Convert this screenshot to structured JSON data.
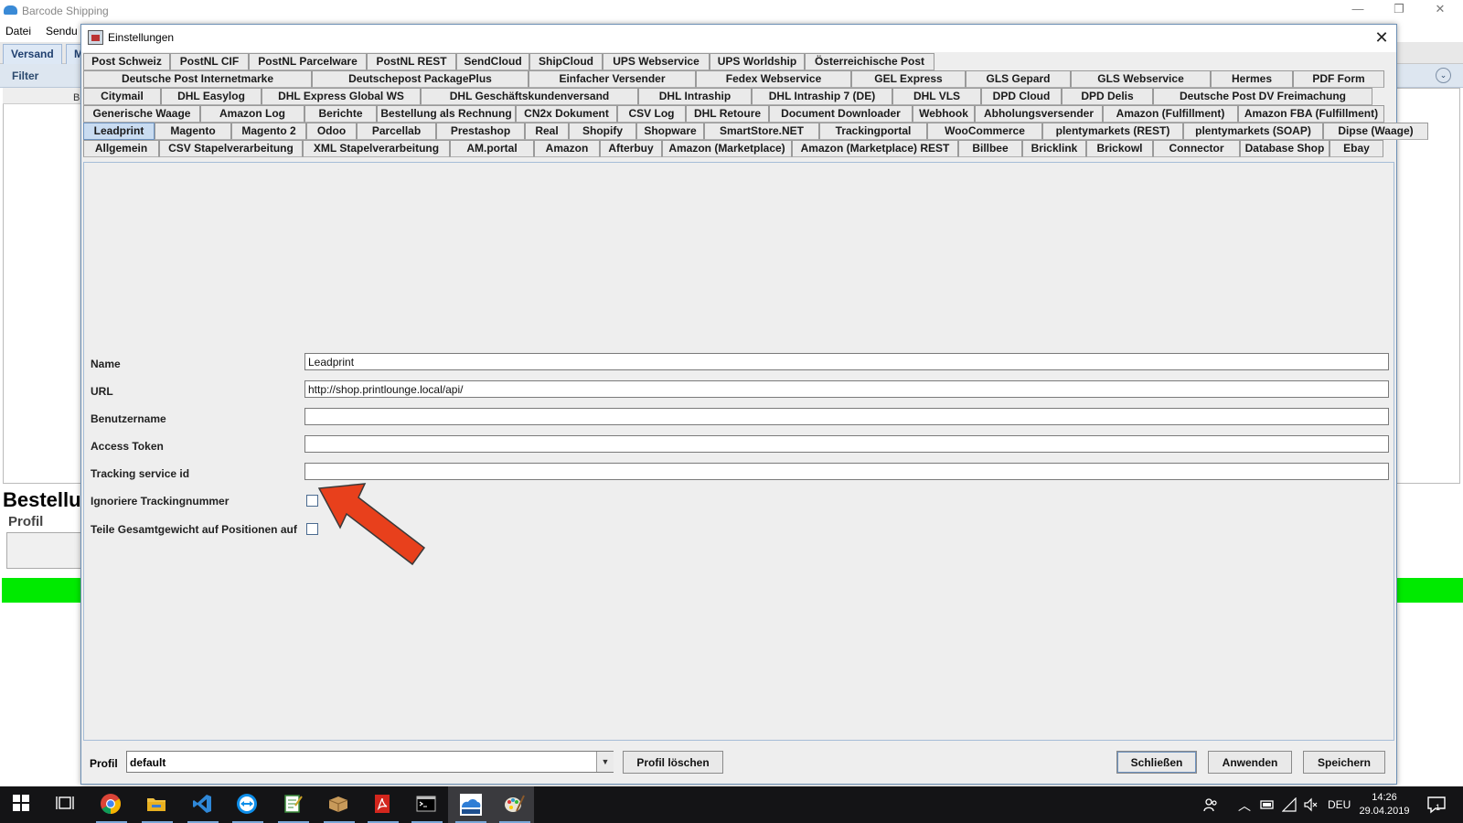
{
  "app": {
    "title": "Barcode Shipping",
    "window_controls": {
      "minimize": "—",
      "restore": "❐",
      "close": "✕"
    },
    "menu": [
      "Datei",
      "Sendu"
    ],
    "tabs": [
      "Versand",
      "M"
    ],
    "filter_label": "Filter",
    "panel_row_text": "B",
    "bestellung_heading": "Bestellu",
    "profil_label": "Profil",
    "collapse_icon": "⌄",
    "green_status_color": "#00ea00"
  },
  "dialog": {
    "title": "Einstellungen",
    "close_symbol": "✕",
    "tab_rows": [
      [
        "Post Schweiz",
        "PostNL CIF",
        "PostNL Parcelware",
        "PostNL REST",
        "SendCloud",
        "ShipCloud",
        "UPS Webservice",
        "UPS Worldship",
        "Österreichische Post"
      ],
      [
        "Deutsche Post Internetmarke",
        "Deutschepost PackagePlus",
        "Einfacher Versender",
        "Fedex Webservice",
        "GEL Express",
        "GLS Gepard",
        "GLS Webservice",
        "Hermes",
        "PDF Form"
      ],
      [
        "Citymail",
        "DHL Easylog",
        "DHL Express Global WS",
        "DHL Geschäftskundenversand",
        "DHL Intraship",
        "DHL Intraship 7 (DE)",
        "DHL VLS",
        "DPD Cloud",
        "DPD Delis",
        "Deutsche Post DV Freimachung"
      ],
      [
        "Generische Waage",
        "Amazon Log",
        "Berichte",
        "Bestellung als Rechnung",
        "CN2x Dokument",
        "CSV Log",
        "DHL Retoure",
        "Document Downloader",
        "Webhook",
        "Abholungsversender",
        "Amazon (Fulfillment)",
        "Amazon FBA (Fulfillment)"
      ],
      [
        "Leadprint",
        "Magento",
        "Magento 2",
        "Odoo",
        "Parcellab",
        "Prestashop",
        "Real",
        "Shopify",
        "Shopware",
        "SmartStore.NET",
        "Trackingportal",
        "WooCommerce",
        "plentymarkets (REST)",
        "plentymarkets (SOAP)",
        "Dipse (Waage)"
      ],
      [
        "Allgemein",
        "CSV Stapelverarbeitung",
        "XML Stapelverarbeitung",
        "AM.portal",
        "Amazon",
        "Afterbuy",
        "Amazon (Marketplace)",
        "Amazon (Marketplace) REST",
        "Billbee",
        "Bricklink",
        "Brickowl",
        "Connector",
        "Database Shop",
        "Ebay"
      ]
    ],
    "active_tab": "Leadprint",
    "form": {
      "name_label": "Name",
      "name_value": "Leadprint",
      "url_label": "URL",
      "url_value": "http://shop.printlounge.local/api/",
      "username_label": "Benutzername",
      "username_value": "",
      "token_label": "Access Token",
      "token_value": "",
      "tracking_id_label": "Tracking service id",
      "tracking_id_value": "",
      "ignore_tracking_label": "Ignoriere Trackingnummer",
      "ignore_tracking_checked": false,
      "split_weight_label": "Teile Gesamtgewicht auf Positionen auf",
      "split_weight_checked": false
    },
    "annotation_arrow_color": "#e8401c",
    "bottom": {
      "profil_label": "Profil",
      "profil_value": "default",
      "delete_profile_button": "Profil löschen",
      "close_button": "Schließen",
      "apply_button": "Anwenden",
      "save_button": "Speichern"
    }
  },
  "taskbar": {
    "icons": [
      "windows-start-icon",
      "task-view-icon",
      "chrome-icon",
      "file-explorer-icon",
      "vscode-icon",
      "teamviewer-icon",
      "notepad-icon",
      "package-icon",
      "acrobat-icon",
      "terminal-icon",
      "barcode-shipping-icon",
      "paint-icon"
    ],
    "language": "DEU",
    "time": "14:26",
    "date": "29.04.2019",
    "notification_count": "1"
  }
}
